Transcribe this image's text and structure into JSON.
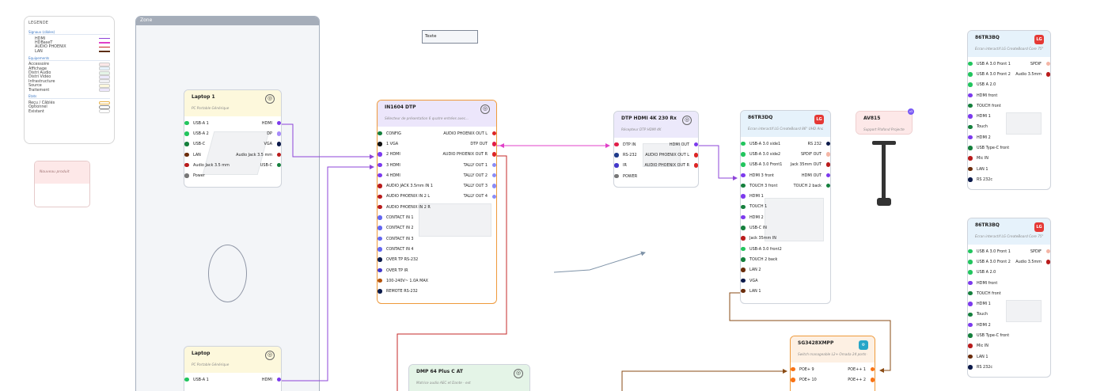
{
  "legend": {
    "title": "LEGENDE",
    "signals_title": "Signaux (câbles)",
    "signals": [
      {
        "label": "HDMI",
        "color": "#8e44d8"
      },
      {
        "label": "HDBaseT",
        "color": "#e040c8"
      },
      {
        "label": "AUDIO PHOENIX",
        "color": "#c62828"
      },
      {
        "label": "LAN",
        "color": "#5d2e0e"
      }
    ],
    "equip_title": "Equipements",
    "equipment": [
      {
        "label": "Accessoire",
        "color": "#fde8e8"
      },
      {
        "label": "Affichage",
        "color": "#e6f2fb"
      },
      {
        "label": "Distri Audio",
        "color": "#e4f4e7"
      },
      {
        "label": "Distri Vidéo",
        "color": "#ece9fb"
      },
      {
        "label": "Infrastructure",
        "color": "#f1f1f4"
      },
      {
        "label": "Source",
        "color": "#fdf8dc"
      },
      {
        "label": "Traitement",
        "color": "#ece6fb"
      }
    ],
    "state_title": "Etats",
    "states": [
      {
        "label": "Reçu / Câblés",
        "color": "#e7b24a"
      },
      {
        "label": "Optionnel",
        "color": "#888888"
      },
      {
        "label": "Existant",
        "color": "#cccccc"
      }
    ]
  },
  "new_product": {
    "label": "Nouveau produit"
  },
  "zone": {
    "title": "Zone"
  },
  "text_box": {
    "label": "Texte"
  },
  "laptop1": {
    "name": "Laptop 1",
    "desc": "PC Portable Générique",
    "rows": [
      {
        "l": "USB-A 1",
        "r": "HDMI",
        "lc": "#22c55e",
        "rc": "#7c3aed"
      },
      {
        "l": "USB-A 2",
        "r": "DP",
        "lc": "#22c55e",
        "rc": "#a78bfa"
      },
      {
        "l": "USB-C",
        "r": "VGA",
        "lc": "#15803d",
        "rc": "#0b1a4a"
      },
      {
        "l": "LAN",
        "r": "Audio Jack 3.5 mm",
        "lc": "#6b2d0c",
        "rc": "#b91c1c"
      },
      {
        "l": "Audio Jack 3.5 mm",
        "r": "USB-C",
        "lc": "#b91c1c",
        "rc": "#15803d"
      },
      {
        "l": "Power",
        "r": "",
        "lc": "#777777",
        "rc": ""
      }
    ]
  },
  "laptop2": {
    "name": "Laptop",
    "desc": "PC Portable Générique",
    "rows": [
      {
        "l": "USB-A 1",
        "r": "HDMI",
        "lc": "#22c55e",
        "rc": "#7c3aed"
      }
    ]
  },
  "in1604": {
    "name": "IN1604 DTP",
    "desc": "Sélecteur de présentation 6 quatre entrées avec...",
    "rows": [
      {
        "l": "CONFIG",
        "r": "AUDIO PHOENIX OUT L",
        "lc": "#15803d",
        "rc": "#dc2626"
      },
      {
        "l": "1 VGA",
        "r": "DTP OUT",
        "lc": "#111111",
        "rc": "#e11d48"
      },
      {
        "l": "2 HDMI",
        "r": "AUDIO PHOENIX OUT R",
        "lc": "#7c3aed",
        "rc": "#dc2626"
      },
      {
        "l": "3 HDMI",
        "r": "TALLY OUT 1",
        "lc": "#7c3aed",
        "rc": "#8b8cf5"
      },
      {
        "l": "4 HDMI",
        "r": "TALLY OUT 2",
        "lc": "#7c3aed",
        "rc": "#8b8cf5"
      },
      {
        "l": "AUDIO JACK 3.5mm IN 1",
        "r": "TALLY OUT 3",
        "lc": "#b91c1c",
        "rc": "#8b8cf5"
      },
      {
        "l": "AUDIO PHOENIX IN 2 L",
        "r": "TALLY OUT 4",
        "lc": "#b91c1c",
        "rc": "#8b8cf5"
      },
      {
        "l": "AUDIO PHOENIX IN 2 R",
        "r": "",
        "lc": "#b91c1c",
        "rc": ""
      },
      {
        "l": "CONTACT IN 1",
        "r": "",
        "lc": "#6366f1",
        "rc": ""
      },
      {
        "l": "CONTACT IN 2",
        "r": "",
        "lc": "#6366f1",
        "rc": ""
      },
      {
        "l": "CONTACT IN 3",
        "r": "",
        "lc": "#6366f1",
        "rc": ""
      },
      {
        "l": "CONTACT IN 4",
        "r": "",
        "lc": "#6366f1",
        "rc": ""
      },
      {
        "l": "OVER TP RS-232",
        "r": "",
        "lc": "#0b1a4a",
        "rc": ""
      },
      {
        "l": "OVER TP IR",
        "r": "",
        "lc": "#4338ca",
        "rc": ""
      },
      {
        "l": "100-240V~ 1.0A MAX",
        "r": "",
        "lc": "#b45309",
        "rc": ""
      },
      {
        "l": "REMOTE RS-232",
        "r": "",
        "lc": "#0b1a4a",
        "rc": ""
      }
    ]
  },
  "dtp": {
    "name": "DTP HDMI 4K 230 Rx",
    "desc": "Récepteur DTP HDMI 4K",
    "rows": [
      {
        "l": "DTP IN",
        "r": "HDMI OUT",
        "lc": "#e11d48",
        "rc": "#7c3aed"
      },
      {
        "l": "RS-232",
        "r": "AUDIO PHOENIX OUT L",
        "lc": "#1e3a8a",
        "rc": "#dc2626"
      },
      {
        "l": "IR",
        "r": "AUDIO PHOENIX OUT R",
        "lc": "#4338ca",
        "rc": "#dc2626"
      },
      {
        "l": "POWER",
        "r": "",
        "lc": "#777777",
        "rc": ""
      }
    ]
  },
  "lg86dq": {
    "name": "86TR3DQ",
    "desc": "Écran interactif LG CreateBoard 86\" UHD And...",
    "rows": [
      {
        "l": "USB-A 3.0 side1",
        "r": "RS 232",
        "lc": "#22c55e",
        "rc": "#0b1a4a"
      },
      {
        "l": "USB-A 3.0 side2",
        "r": "SPDIF OUT",
        "lc": "#22c55e",
        "rc": "#f4b6a6"
      },
      {
        "l": "USB-A 3.0 Front1",
        "r": "Jack 35mm OUT",
        "lc": "#22c55e",
        "rc": "#b91c1c"
      },
      {
        "l": "HDMI 3 front",
        "r": "HDMI OUT",
        "lc": "#7c3aed",
        "rc": "#7c3aed"
      },
      {
        "l": "TOUCH 3 front",
        "r": "TOUCH 2 back",
        "lc": "#15803d",
        "rc": "#15803d"
      },
      {
        "l": "HDMI 1",
        "r": "",
        "lc": "#7c3aed",
        "rc": ""
      },
      {
        "l": "TOUCH 1",
        "r": "",
        "lc": "#15803d",
        "rc": ""
      },
      {
        "l": "HDMI 2",
        "r": "",
        "lc": "#7c3aed",
        "rc": ""
      },
      {
        "l": "USB-C IN",
        "r": "",
        "lc": "#15803d",
        "rc": ""
      },
      {
        "l": "Jack 35mm IN",
        "r": "",
        "lc": "#b91c1c",
        "rc": ""
      },
      {
        "l": "USB-A 3.0 front2",
        "r": "",
        "lc": "#22c55e",
        "rc": ""
      },
      {
        "l": "TOUCH 2 back",
        "r": "",
        "lc": "#15803d",
        "rc": ""
      },
      {
        "l": "LAN 2",
        "r": "",
        "lc": "#6b2d0c",
        "rc": ""
      },
      {
        "l": "VGA",
        "r": "",
        "lc": "#0b1a4a",
        "rc": ""
      },
      {
        "l": "LAN 1",
        "r": "",
        "lc": "#6b2d0c",
        "rc": ""
      }
    ]
  },
  "av815": {
    "name": "AV815",
    "desc": "Support Plafond Projecteur",
    "badge": "x3"
  },
  "lg86bq_top": {
    "name": "86TR3BQ",
    "desc": "Écran interactif LG CreateBoard Core 75\"",
    "rows": [
      {
        "l": "USB A 3.0 Front 1",
        "r": "SPDIF",
        "lc": "#22c55e",
        "rc": "#f4b6a6"
      },
      {
        "l": "USB A 3.0 Front 2",
        "r": "Audio 3.5mm",
        "lc": "#22c55e",
        "rc": "#b91c1c"
      },
      {
        "l": "USB A 2.0",
        "r": "",
        "lc": "#22c55e",
        "rc": ""
      },
      {
        "l": "HDMI front",
        "r": "",
        "lc": "#7c3aed",
        "rc": ""
      },
      {
        "l": "TOUCH front",
        "r": "",
        "lc": "#15803d",
        "rc": ""
      },
      {
        "l": "HDMI 1",
        "r": "",
        "lc": "#7c3aed",
        "rc": ""
      },
      {
        "l": "Touch",
        "r": "",
        "lc": "#15803d",
        "rc": ""
      },
      {
        "l": "HDMI 2",
        "r": "",
        "lc": "#7c3aed",
        "rc": ""
      },
      {
        "l": "USB Type-C front",
        "r": "",
        "lc": "#15803d",
        "rc": ""
      },
      {
        "l": "Mic IN",
        "r": "",
        "lc": "#b91c1c",
        "rc": ""
      },
      {
        "l": "LAN 1",
        "r": "",
        "lc": "#6b2d0c",
        "rc": ""
      },
      {
        "l": "RS 232c",
        "r": "",
        "lc": "#0b1a4a",
        "rc": ""
      }
    ]
  },
  "lg86bq_bot": {
    "name": "86TR3BQ",
    "desc": "Écran interactif LG CreateBoard Core 75\"",
    "rows": [
      {
        "l": "USB A 3.0 Front 1",
        "r": "SPDIF",
        "lc": "#22c55e",
        "rc": "#f4b6a6"
      },
      {
        "l": "USB A 3.0 Front 2",
        "r": "Audio 3.5mm",
        "lc": "#22c55e",
        "rc": "#b91c1c"
      },
      {
        "l": "USB A 2.0",
        "r": "",
        "lc": "#22c55e",
        "rc": ""
      },
      {
        "l": "HDMI front",
        "r": "",
        "lc": "#7c3aed",
        "rc": ""
      },
      {
        "l": "TOUCH front",
        "r": "",
        "lc": "#15803d",
        "rc": ""
      },
      {
        "l": "HDMI 1",
        "r": "",
        "lc": "#7c3aed",
        "rc": ""
      },
      {
        "l": "Touch",
        "r": "",
        "lc": "#15803d",
        "rc": ""
      },
      {
        "l": "HDMI 2",
        "r": "",
        "lc": "#7c3aed",
        "rc": ""
      },
      {
        "l": "USB Type-C front",
        "r": "",
        "lc": "#15803d",
        "rc": ""
      },
      {
        "l": "Mic IN",
        "r": "",
        "lc": "#b91c1c",
        "rc": ""
      },
      {
        "l": "LAN 1",
        "r": "",
        "lc": "#6b2d0c",
        "rc": ""
      },
      {
        "l": "RS 232c",
        "r": "",
        "lc": "#0b1a4a",
        "rc": ""
      }
    ]
  },
  "switch": {
    "name": "SG3428XMPP",
    "desc": "Switch manageable L2+ Omada 24 ports Gigabit...",
    "rows": [
      {
        "l": "POE+ 9",
        "r": "POE++ 1",
        "lc": "#f97316",
        "rc": "#f97316"
      },
      {
        "l": "POE+ 10",
        "r": "POE++ 2",
        "lc": "#f97316",
        "rc": "#f97316"
      }
    ]
  },
  "dmp": {
    "name": "DMP 64 Plus C AT",
    "desc": "Matrice audio AEC et Dante - ext"
  },
  "colors": {
    "hdmi": "#8e44d8",
    "hdbaset": "#e040c8",
    "audio": "#c62828",
    "lan": "#8a4b14",
    "select": "#ef9a3b"
  }
}
